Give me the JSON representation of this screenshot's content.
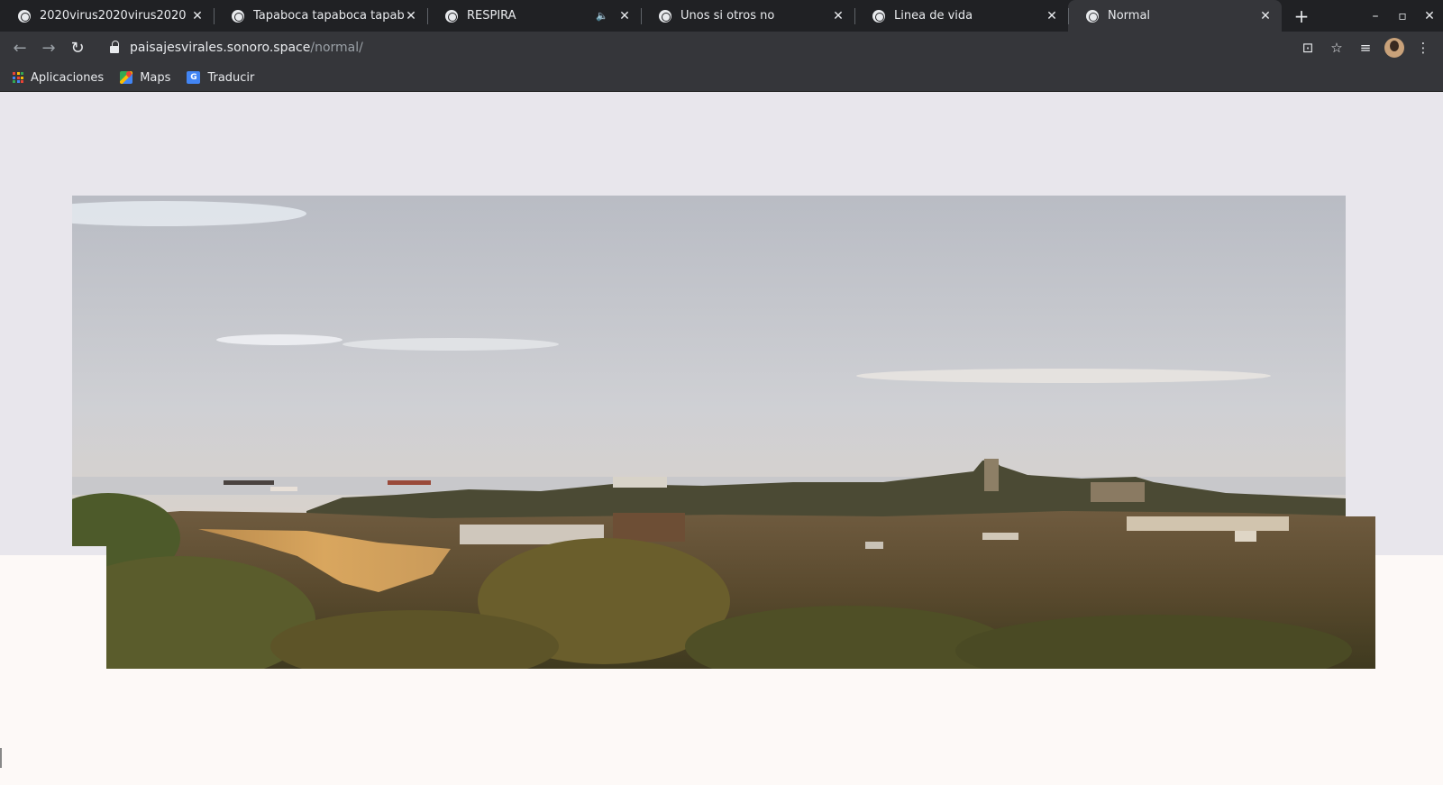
{
  "browser": {
    "tabs": [
      {
        "title": "2020virus2020virus2020",
        "active": false,
        "audio": false
      },
      {
        "title": "Tapaboca tapaboca tapaboca",
        "active": false,
        "audio": false
      },
      {
        "title": "RESPIRA",
        "active": false,
        "audio": true
      },
      {
        "title": "Unos si otros no",
        "active": false,
        "audio": false
      },
      {
        "title": "Linea de vida",
        "active": false,
        "audio": false
      },
      {
        "title": "Normal",
        "active": true,
        "audio": false
      }
    ],
    "url_host": "paisajesvirales.sonoro.space",
    "url_path": "/normal/",
    "bookmarks": [
      {
        "label": "Aplicaciones",
        "icon": "apps-grid-icon"
      },
      {
        "label": "Maps",
        "icon": "google-maps-icon"
      },
      {
        "label": "Traducir",
        "icon": "google-translate-icon"
      }
    ]
  },
  "colors": {
    "tab_strip": "#202124",
    "toolbar": "#35363a",
    "page_upper_band": "#e8e6ec",
    "page_background": "#fdf9f7"
  },
  "page": {
    "image": "panoramic-landscape-photo"
  }
}
